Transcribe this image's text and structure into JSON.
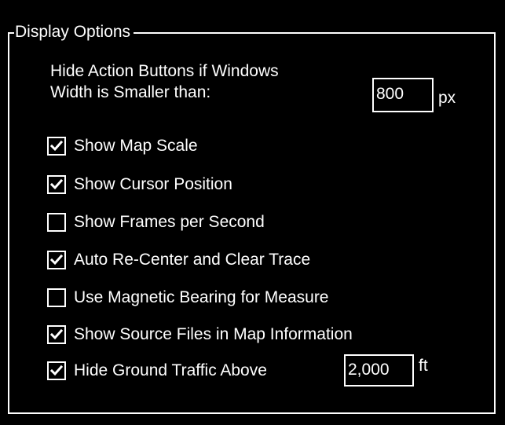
{
  "group": {
    "title": "Display Options"
  },
  "hide_buttons": {
    "label_line1": "Hide Action Buttons if Windows",
    "label_line2": "Width is Smaller than:",
    "value": "800",
    "unit": "px"
  },
  "options": [
    {
      "label": "Show Map Scale",
      "checked": true
    },
    {
      "label": "Show Cursor Position",
      "checked": true
    },
    {
      "label": "Show Frames per Second",
      "checked": false
    },
    {
      "label": "Auto Re-Center and Clear Trace",
      "checked": true
    },
    {
      "label": "Use Magnetic Bearing for Measure",
      "checked": false
    },
    {
      "label": "Show Source Files in Map Information",
      "checked": true
    },
    {
      "label": "Hide Ground Traffic Above",
      "checked": true
    }
  ],
  "ground_traffic": {
    "value": "2,000",
    "unit": "ft"
  },
  "colors": {
    "background": "#000000",
    "foreground": "#ffffff"
  },
  "icons": {
    "check": "checkmark-icon"
  }
}
